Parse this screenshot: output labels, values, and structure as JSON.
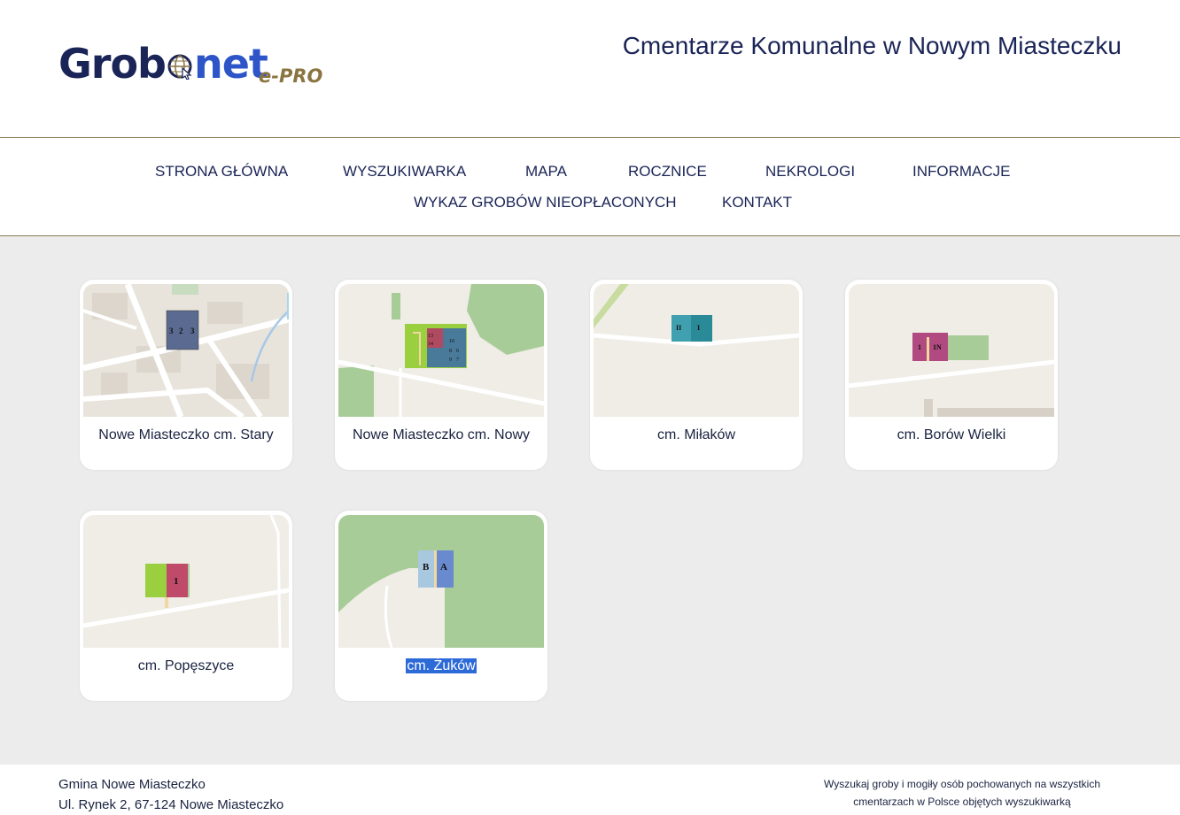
{
  "header": {
    "logo_text_a": "Grob",
    "logo_text_b": "net",
    "logo_sub": "e-PRO",
    "site_title": "Cmentarze Komunalne w Nowym Miasteczku"
  },
  "nav": {
    "items": [
      {
        "label": "STRONA GŁÓWNA"
      },
      {
        "label": "WYSZUKIWARKA"
      },
      {
        "label": "MAPA"
      },
      {
        "label": "ROCZNICE"
      },
      {
        "label": "NEKROLOGI"
      },
      {
        "label": "INFORMACJE"
      },
      {
        "label": "WYKAZ GROBÓW NIEOPŁACONYCH"
      },
      {
        "label": "KONTAKT"
      }
    ]
  },
  "cemeteries": [
    {
      "name": "Nowe Miasteczko cm. Stary",
      "sections": [
        "3",
        "2",
        "3"
      ]
    },
    {
      "name": "Nowe Miasteczko cm. Nowy",
      "sections": [
        "13",
        "14",
        "10",
        "8",
        "9",
        "6",
        "7"
      ]
    },
    {
      "name": "cm. Miłaków",
      "sections": [
        "II",
        "I"
      ]
    },
    {
      "name": "cm. Borów Wielki",
      "sections": [
        "1",
        "1N"
      ]
    },
    {
      "name": "cm. Popęszyce",
      "sections": [
        "1"
      ]
    },
    {
      "name": "cm. Żuków",
      "sections": [
        "B",
        "A"
      ],
      "selected": true
    }
  ],
  "footer": {
    "address_line1": "Gmina Nowe Miasteczko",
    "address_line2": "Ul. Rynek 2, 67-124 Nowe Miasteczko",
    "note": "Wyszukaj groby i mogiły osób pochowanych na wszystkich cmentarzach w Polsce objętych wyszukiwarką"
  },
  "colors": {
    "brand_dark": "#1a2456",
    "brand_blue": "#2d55c8",
    "brand_gold": "#8a7440",
    "selection": "#2c6ad8",
    "background_main": "#ececec"
  }
}
